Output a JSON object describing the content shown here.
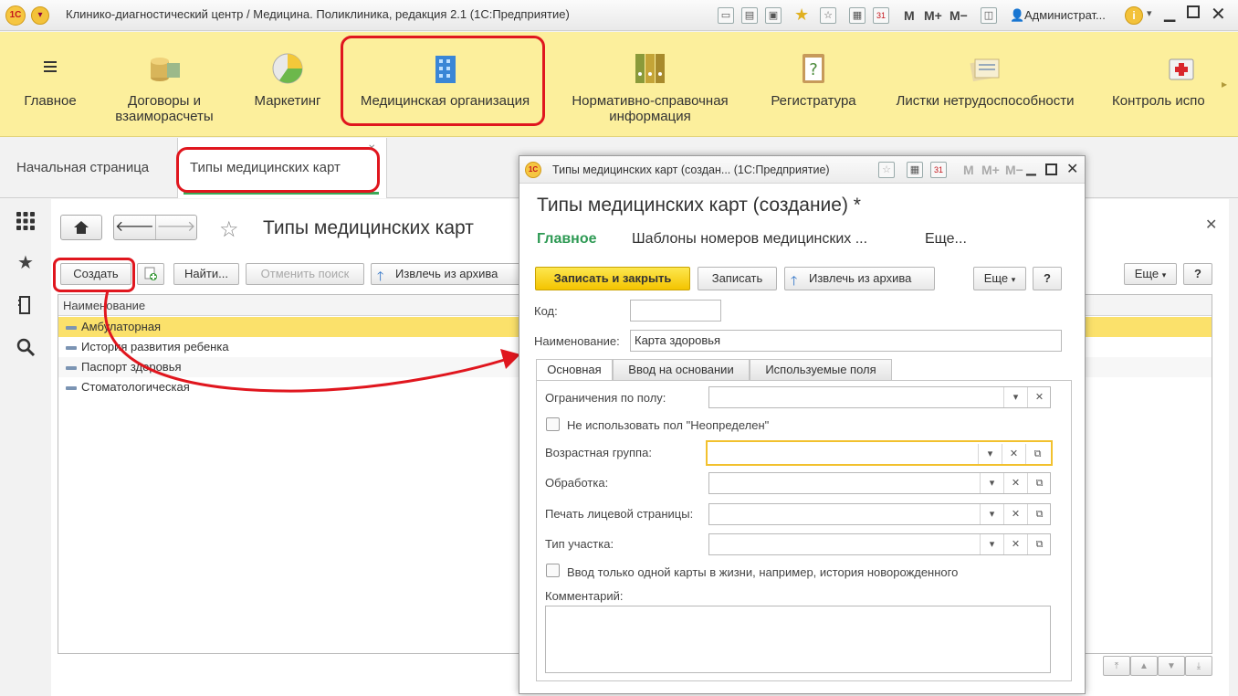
{
  "window": {
    "title": "Клинико-диагностический центр / Медицина. Поликлиника, редакция 2.1  (1С:Предприятие)",
    "user": "Администрат...",
    "toolbar": {
      "m": "M",
      "mplus": "M+",
      "mminus": "M−",
      "cal": "31"
    }
  },
  "sections": [
    {
      "label": "Главное",
      "icon": "menu-icon"
    },
    {
      "label": "Договоры и взаиморасчеты",
      "icon": "coins-icon"
    },
    {
      "label": "Маркетинг",
      "icon": "pie-chart-icon"
    },
    {
      "label": "Медицинская организация",
      "icon": "building-icon"
    },
    {
      "label": "Нормативно-справочная информация",
      "icon": "binders-icon"
    },
    {
      "label": "Регистратура",
      "icon": "clipboard-question-icon"
    },
    {
      "label": "Листки нетрудоспособности",
      "icon": "documents-icon"
    },
    {
      "label": "Контроль испо",
      "icon": "first-aid-icon"
    }
  ],
  "open_tabs": [
    {
      "label": "Начальная страница"
    },
    {
      "label": "Типы медицинских карт"
    }
  ],
  "list": {
    "title": "Типы медицинских карт",
    "buttons": {
      "create": "Создать",
      "find": "Найти...",
      "cancel_search": "Отменить поиск",
      "archive": "Извлечь из архива",
      "more": "Еще",
      "help": "?"
    },
    "column": "Наименование",
    "rows": [
      "Амбулаторная",
      "История развития ребенка",
      "Паспорт здоровья",
      "Стоматологическая"
    ]
  },
  "dialog": {
    "window_title": "Типы медицинских карт (создан...  (1С:Предприятие)",
    "header": "Типы медицинских карт (создание) *",
    "nav": {
      "main": "Главное",
      "templates": "Шаблоны номеров медицинских ...",
      "more": "Еще..."
    },
    "buttons": {
      "save_close": "Записать и закрыть",
      "save": "Записать",
      "archive": "Извлечь из архива",
      "more": "Еще",
      "help": "?"
    },
    "fields": {
      "code_label": "Код:",
      "code_value": "",
      "name_label": "Наименование:",
      "name_value": "Карта здоровья"
    },
    "tabs": [
      "Основная",
      "Ввод на основании",
      "Используемые поля"
    ],
    "form": {
      "gender_label": "Ограничения по полу:",
      "no_undefined_gender": "Не использовать пол \"Неопределен\"",
      "age_group_label": "Возрастная группа:",
      "processing_label": "Обработка:",
      "print_label": "Печать лицевой страницы:",
      "area_type_label": "Тип участка:",
      "one_card_label": "Ввод только одной карты в жизни, например, история новорожденного",
      "comment_label": "Комментарий:"
    }
  },
  "colors": {
    "accent_green": "#2e9a54",
    "annotation_red": "#e0161e",
    "section_panel": "#fcef9c",
    "selected_row": "#fbe16b"
  }
}
